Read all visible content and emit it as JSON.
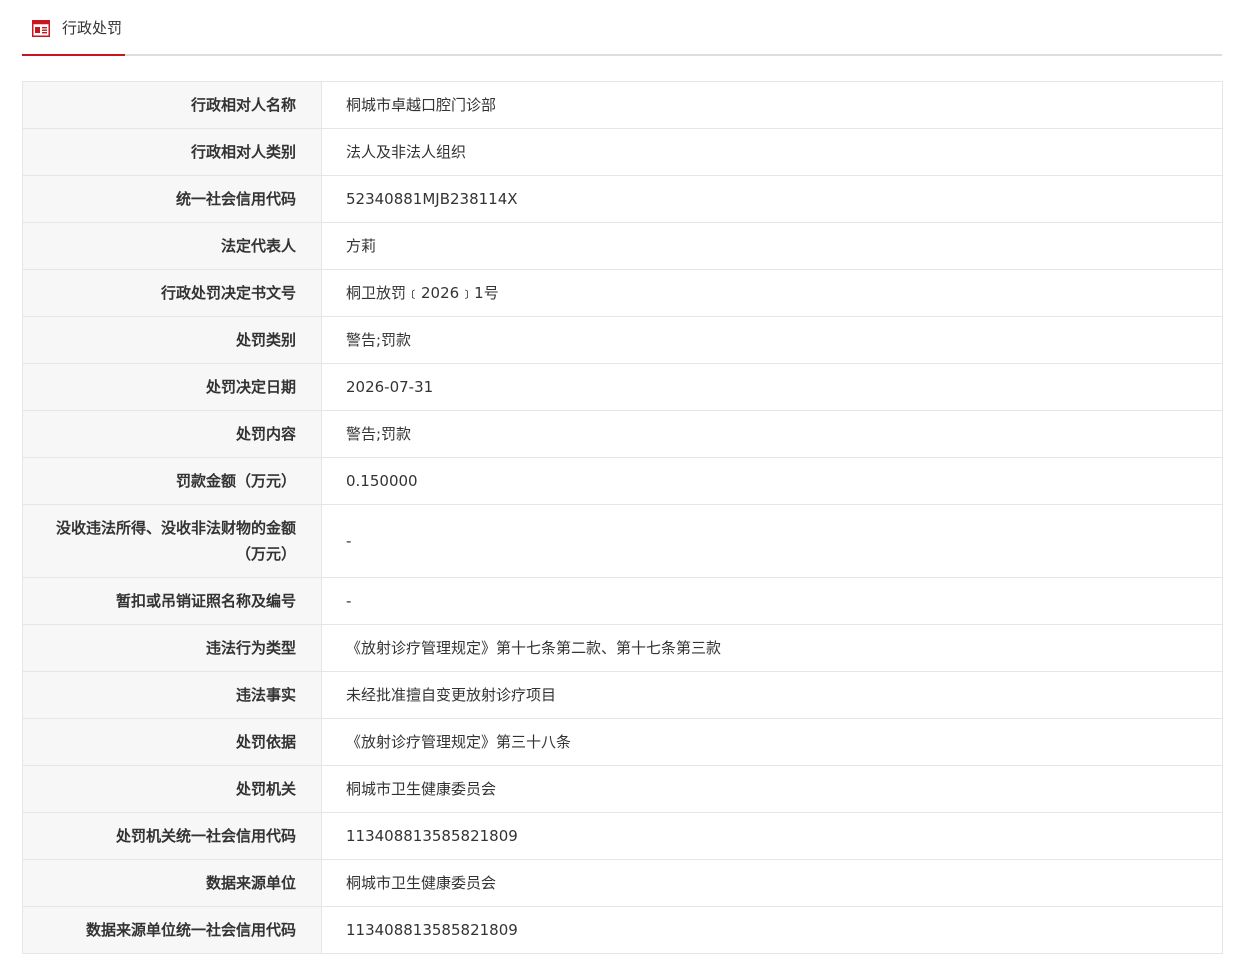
{
  "tab": {
    "label": "行政处罚",
    "icon": "document-icon",
    "accent_color": "#c7161e"
  },
  "rows": [
    {
      "label": "行政相对人名称",
      "value": "桐城市卓越口腔门诊部"
    },
    {
      "label": "行政相对人类别",
      "value": "法人及非法人组织"
    },
    {
      "label": "统一社会信用代码",
      "value": "52340881MJB238114X"
    },
    {
      "label": "法定代表人",
      "value": "方莉"
    },
    {
      "label": "行政处罚决定书文号",
      "value": "桐卫放罚﹝2026﹞1号"
    },
    {
      "label": "处罚类别",
      "value": "警告;罚款"
    },
    {
      "label": "处罚决定日期",
      "value": "2026-07-31"
    },
    {
      "label": "处罚内容",
      "value": "警告;罚款"
    },
    {
      "label": "罚款金额（万元）",
      "value": "0.150000"
    },
    {
      "label": "没收违法所得、没收非法财物的金额（万元）",
      "value": "-"
    },
    {
      "label": "暂扣或吊销证照名称及编号",
      "value": "-"
    },
    {
      "label": "违法行为类型",
      "value": "《放射诊疗管理规定》第十七条第二款、第十七条第三款"
    },
    {
      "label": "违法事实",
      "value": "未经批准擅自变更放射诊疗项目"
    },
    {
      "label": "处罚依据",
      "value": "《放射诊疗管理规定》第三十八条"
    },
    {
      "label": "处罚机关",
      "value": "桐城市卫生健康委员会"
    },
    {
      "label": "处罚机关统一社会信用代码",
      "value": "113408813585821809"
    },
    {
      "label": "数据来源单位",
      "value": "桐城市卫生健康委员会"
    },
    {
      "label": "数据来源单位统一社会信用代码",
      "value": "113408813585821809"
    }
  ]
}
